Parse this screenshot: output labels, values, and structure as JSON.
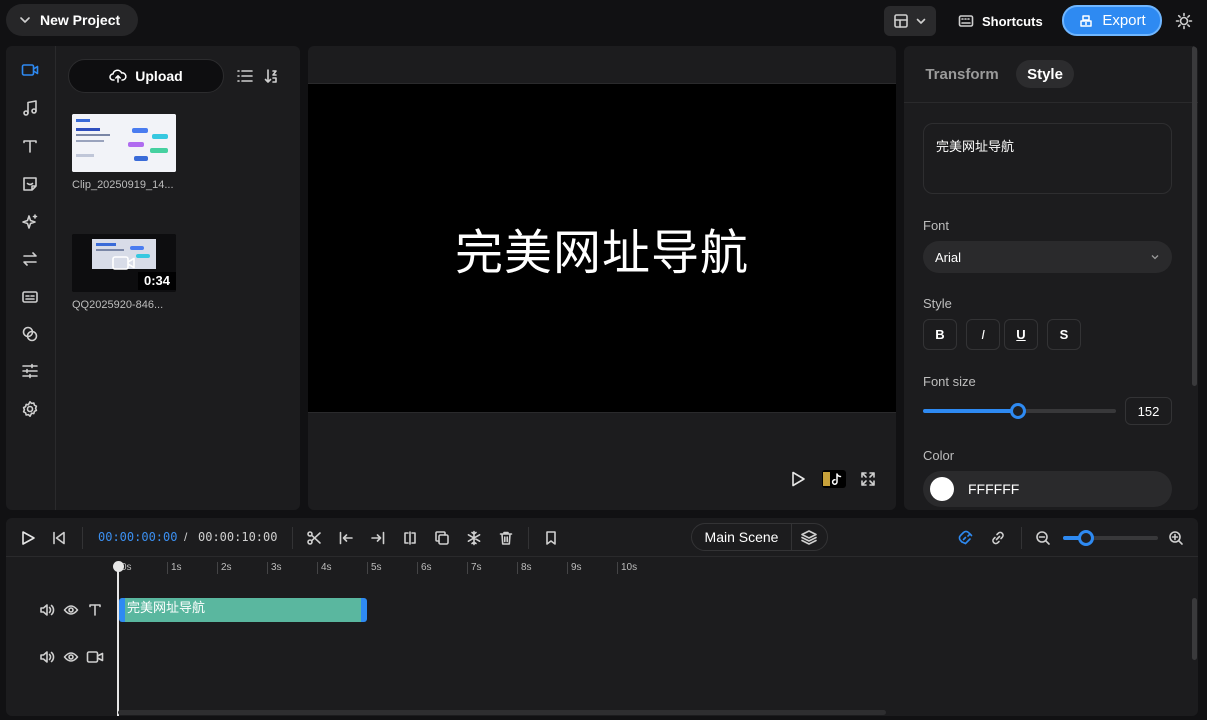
{
  "app": {
    "project_title": "New Project",
    "shortcuts_label": "Shortcuts",
    "export_label": "Export"
  },
  "left_panel": {
    "upload_label": "Upload",
    "media": [
      {
        "name": "Clip_20250919_14...",
        "type": "image"
      },
      {
        "name": "QQ2025920-846...",
        "type": "video",
        "duration": "0:34"
      }
    ],
    "rail_icons": [
      "video-icon",
      "music-icon",
      "text-icon",
      "sticker-icon",
      "effects-icon",
      "transition-icon",
      "caption-icon",
      "filter-icon",
      "adjust-icon",
      "settings-icon"
    ]
  },
  "preview": {
    "canvas_text": "完美网址导航"
  },
  "inspector": {
    "tabs": [
      {
        "label": "Transform",
        "active": false
      },
      {
        "label": "Style",
        "active": true
      }
    ],
    "text_value": "完美网址导航",
    "font_label": "Font",
    "font_value": "Arial",
    "style_label": "Style",
    "style_buttons": [
      "B",
      "I",
      "U",
      "S"
    ],
    "font_size_label": "Font size",
    "font_size_value": "152",
    "font_size_fraction": 0.49,
    "color_label": "Color",
    "color_value": "FFFFFF"
  },
  "timeline": {
    "current_time": "00:00:00:00",
    "separator": "/",
    "total_time": "00:00:10:00",
    "scene_label": "Main Scene",
    "ruler": [
      "0s",
      "1s",
      "2s",
      "3s",
      "4s",
      "5s",
      "6s",
      "7s",
      "8s",
      "9s",
      "10s"
    ],
    "text_clip_label": "完美网址导航",
    "zoom_fraction": 0.23
  },
  "colors": {
    "accent": "#2e8af2",
    "clip": "#5ab79f",
    "background": "#111113",
    "panel": "#1c1c1e"
  }
}
